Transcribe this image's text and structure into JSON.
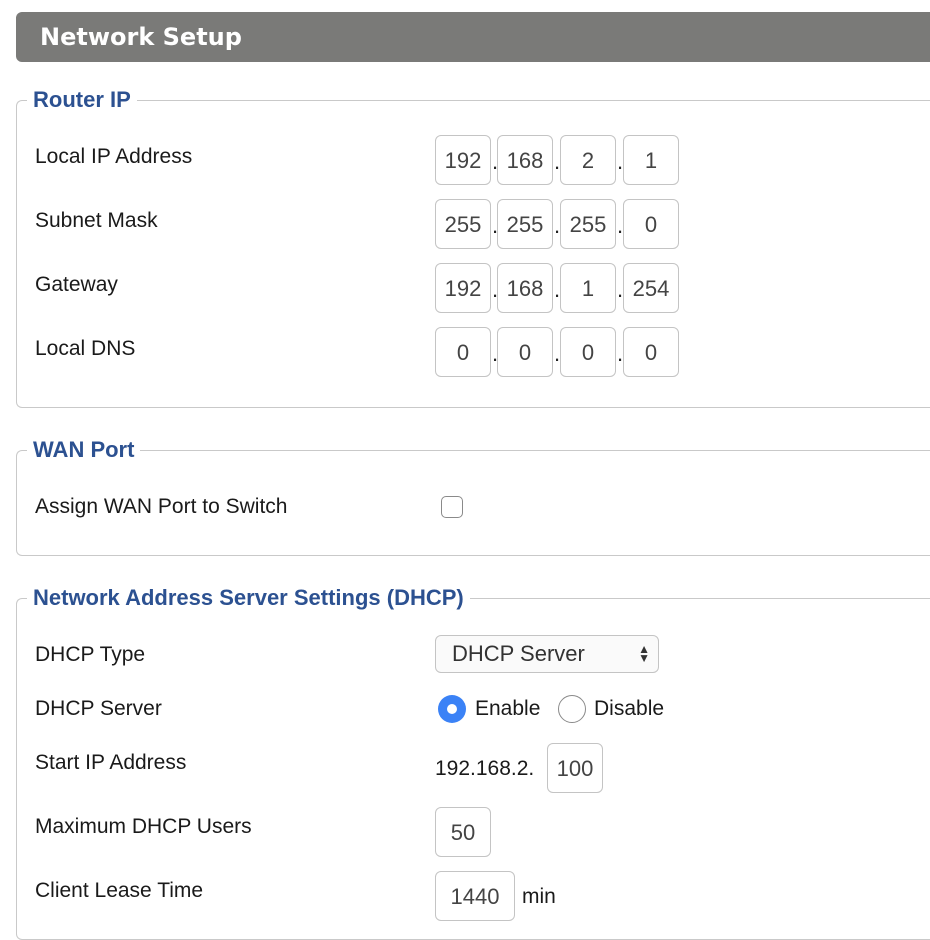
{
  "header": {
    "title": "Network Setup"
  },
  "router_ip": {
    "legend": "Router IP",
    "rows": [
      {
        "label": "Local IP Address",
        "octets": [
          "192",
          "168",
          "2",
          "1"
        ]
      },
      {
        "label": "Subnet Mask",
        "octets": [
          "255",
          "255",
          "255",
          "0"
        ]
      },
      {
        "label": "Gateway",
        "octets": [
          "192",
          "168",
          "1",
          "254"
        ]
      },
      {
        "label": "Local DNS",
        "octets": [
          "0",
          "0",
          "0",
          "0"
        ]
      }
    ],
    "separator": "."
  },
  "wan_port": {
    "legend": "WAN Port",
    "assign_label": "Assign WAN Port to Switch",
    "assign_checked": false
  },
  "dhcp": {
    "legend": "Network Address Server Settings (DHCP)",
    "type_label": "DHCP Type",
    "type_value": "DHCP Server",
    "server_label": "DHCP Server",
    "enable_label": "Enable",
    "disable_label": "Disable",
    "server_enabled": true,
    "start_ip_label": "Start IP Address",
    "start_ip_prefix": "192.168.2.",
    "start_ip_last": "100",
    "max_users_label": "Maximum DHCP Users",
    "max_users": "50",
    "lease_label": "Client Lease Time",
    "lease_time": "1440",
    "lease_unit": "min"
  },
  "icons": {
    "select_arrows": "updown-chevron-icon",
    "radio": "radio-icon",
    "checkbox": "checkbox-icon"
  },
  "colors": {
    "header_bg": "#7a7a78",
    "legend": "#2c5191",
    "radio_on": "#3b82f6"
  }
}
